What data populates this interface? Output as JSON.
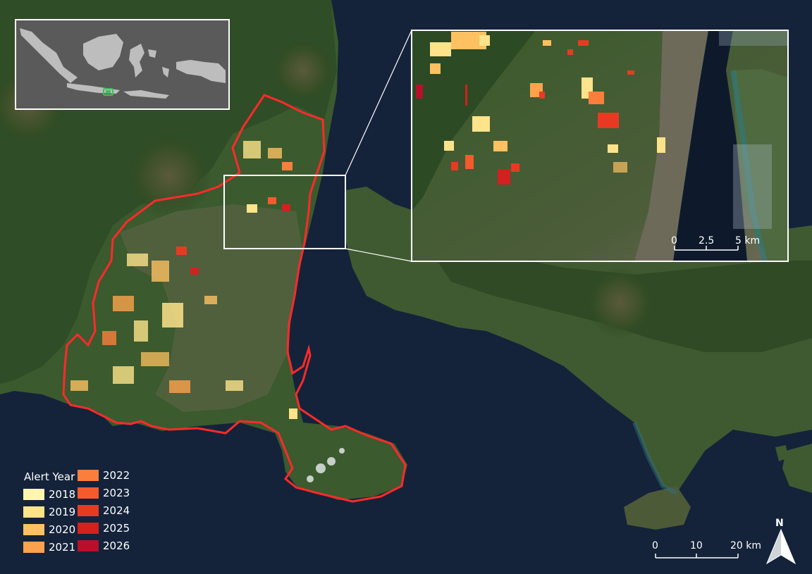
{
  "legend": {
    "title": "Alert Year",
    "items": [
      {
        "year": "2018",
        "color": "#fff5b0"
      },
      {
        "year": "2019",
        "color": "#fde38a"
      },
      {
        "year": "2020",
        "color": "#fdc161"
      },
      {
        "year": "2021",
        "color": "#fda24c"
      },
      {
        "year": "2022",
        "color": "#fb7f3c"
      },
      {
        "year": "2023",
        "color": "#f45a2c"
      },
      {
        "year": "2024",
        "color": "#e83a23"
      },
      {
        "year": "2025",
        "color": "#d4201f"
      },
      {
        "year": "2026",
        "color": "#b8102a"
      }
    ]
  },
  "main_scale": {
    "labels": [
      "0",
      "10",
      "20 km"
    ]
  },
  "inset_scale": {
    "labels": [
      "0",
      "2.5",
      "5 km"
    ]
  },
  "north_arrow": {
    "label": "N"
  },
  "colors": {
    "boundary": "#ff2a2a",
    "sea": "#14233a",
    "land": "#3f5a30",
    "locator_land": "#bdbdbd",
    "locator_bg": "#5a5a5a",
    "locator_marker": "#3fbf5a"
  }
}
